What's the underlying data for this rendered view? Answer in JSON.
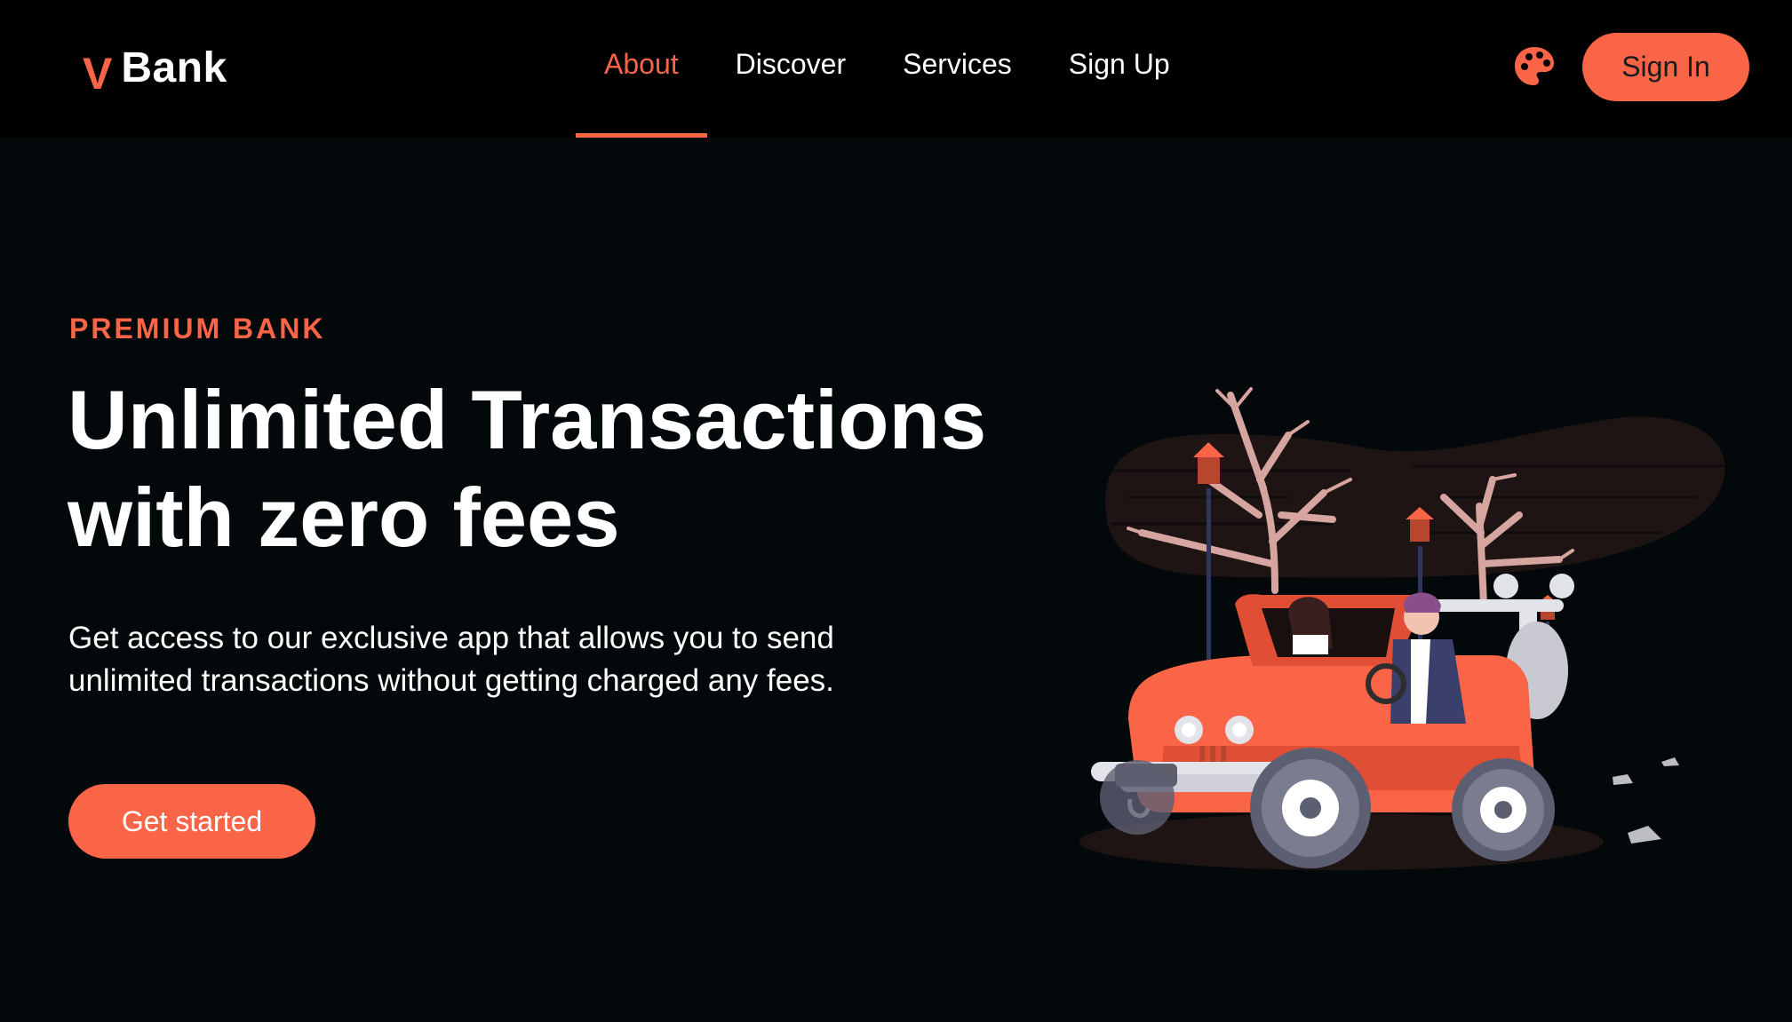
{
  "brand": {
    "mark": "V",
    "name": "Bank"
  },
  "nav": {
    "items": [
      {
        "label": "About",
        "active": true
      },
      {
        "label": "Discover",
        "active": false
      },
      {
        "label": "Services",
        "active": false
      },
      {
        "label": "Sign Up",
        "active": false
      }
    ]
  },
  "header": {
    "theme_icon": "palette-icon",
    "signin_label": "Sign In"
  },
  "hero": {
    "eyebrow": "PREMIUM BANK",
    "headline_line1": "Unlimited Transactions",
    "headline_line2": "with zero fees",
    "description": "Get access to our exclusive app that allows you to send unlimited transactions without getting charged any fees.",
    "cta_label": "Get started",
    "illustration": "jeep-couple-illustration"
  },
  "colors": {
    "accent": "#fa6548",
    "background": "#03080a",
    "header_background": "#000000",
    "text": "#ffffff"
  }
}
